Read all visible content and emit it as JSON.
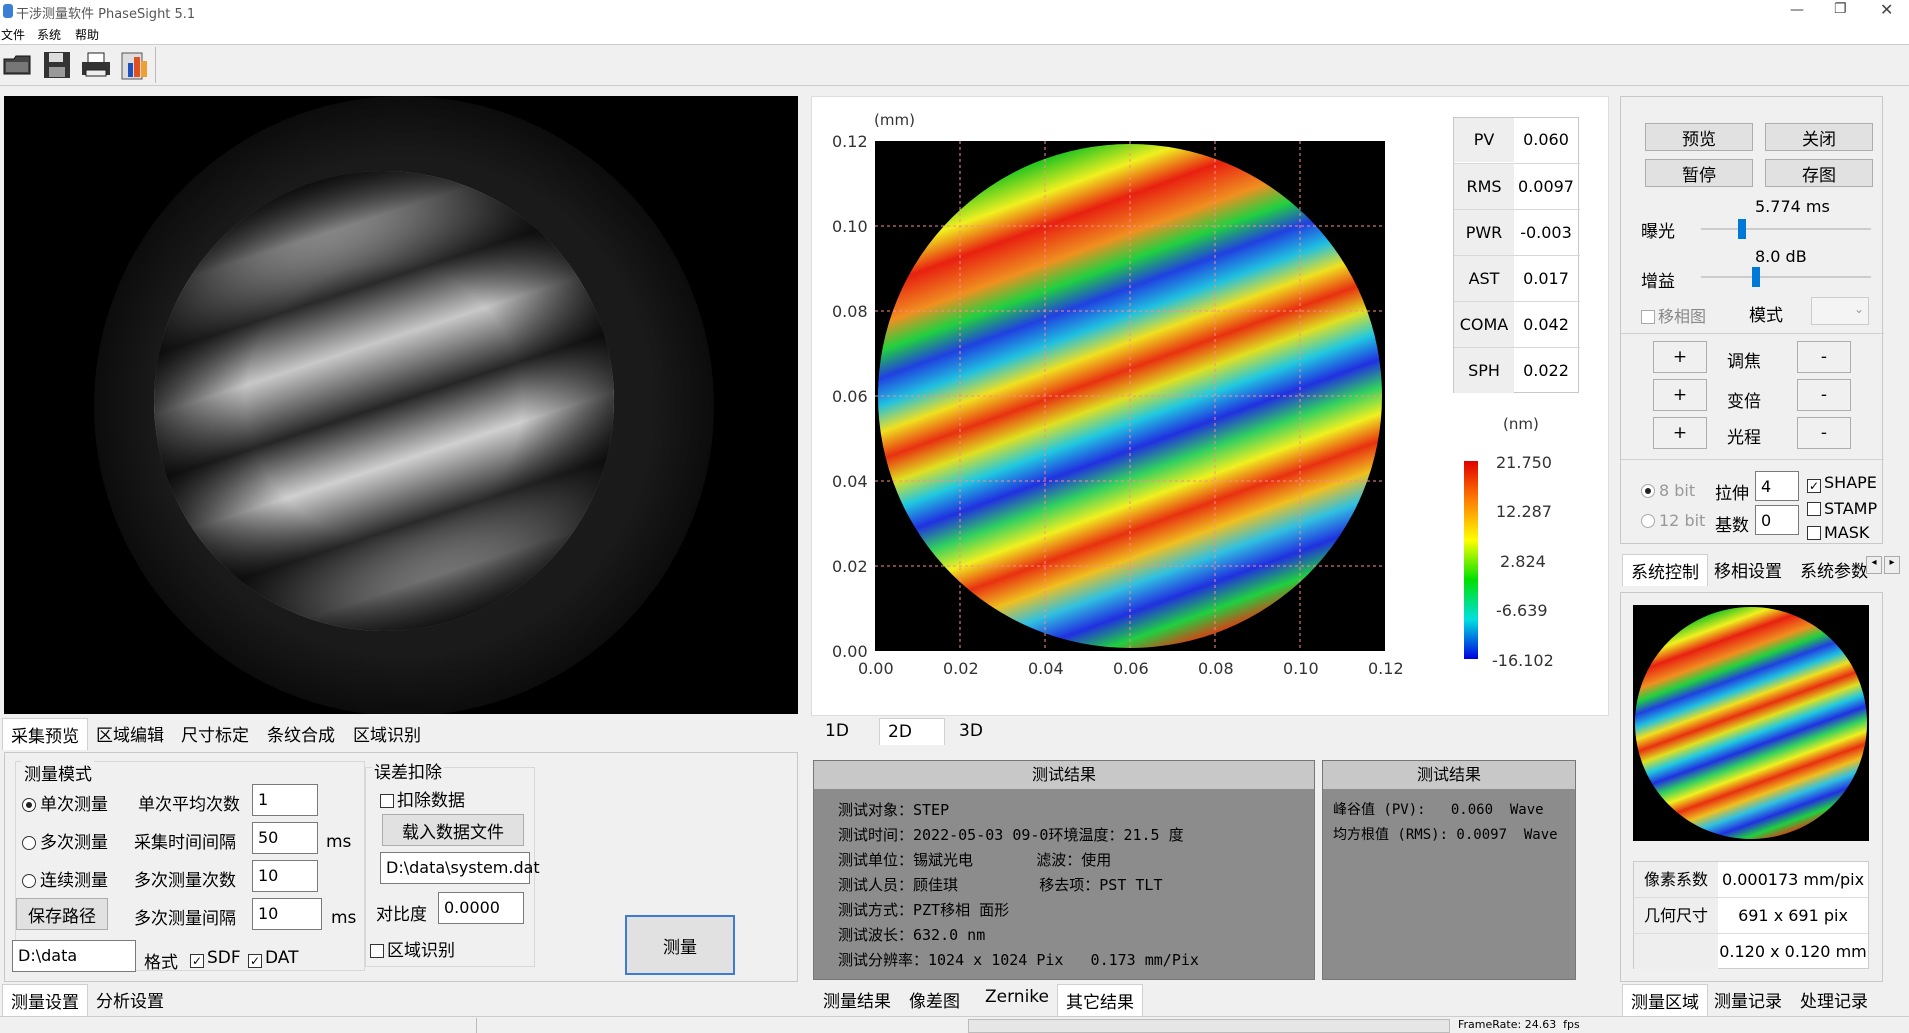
{
  "window": {
    "title": "干涉测量软件 PhaseSight 5.1"
  },
  "menu": [
    "文件",
    "系统",
    "帮助"
  ],
  "toolbar_icons": [
    "open-icon",
    "save-icon",
    "print-icon",
    "report-icon"
  ],
  "left_tabs": [
    "采集预览",
    "区域编辑",
    "尺寸标定",
    "条纹合成",
    "区域识别"
  ],
  "measure_mode": {
    "title": "测量模式",
    "options": [
      "单次测量",
      "多次测量",
      "连续测量"
    ],
    "selected": 0,
    "save_path_label": "保存路径",
    "path_value": "D:\\data",
    "format_label": "格式",
    "sdf_label": "SDF",
    "dat_label": "DAT",
    "avg_label": "单次平均次数",
    "avg_value": "1",
    "interval_label": "采集时间间隔",
    "interval_value": "50",
    "interval_unit": "ms",
    "count_label": "多次测量次数",
    "count_value": "10",
    "multi_interval_label": "多次测量间隔",
    "multi_interval_value": "10",
    "multi_interval_unit": "ms"
  },
  "error_removal": {
    "title": "误差扣除",
    "deduct_label": "扣除数据",
    "load_button": "载入数据文件",
    "file_value": "D:\\data\\system.dat",
    "contrast_label": "对比度",
    "contrast_value": "0.0000",
    "region_label": "区域识别"
  },
  "measure_button": "测量",
  "bottom_left_tabs": [
    "测量设置",
    "分析设置"
  ],
  "plot": {
    "unit": "(mm)",
    "y_ticks": [
      "0.12",
      "0.10",
      "0.08",
      "0.06",
      "0.04",
      "0.02",
      "0.00"
    ],
    "x_ticks": [
      "0.00",
      "0.02",
      "0.04",
      "0.06",
      "0.08",
      "0.10",
      "0.12"
    ]
  },
  "stats": [
    {
      "name": "PV",
      "value": "0.060"
    },
    {
      "name": "RMS",
      "value": "0.0097"
    },
    {
      "name": "PWR",
      "value": "-0.003"
    },
    {
      "name": "AST",
      "value": "0.017"
    },
    {
      "name": "COMA",
      "value": "0.042"
    },
    {
      "name": "SPH",
      "value": "0.022"
    }
  ],
  "colorbar": {
    "unit": "(nm)",
    "labels": [
      "21.750",
      "12.287",
      "2.824",
      "-6.639",
      "-16.102"
    ]
  },
  "view_tabs": [
    "1D",
    "2D",
    "3D"
  ],
  "result_panel": {
    "title": "测试结果",
    "lines": [
      "测试对象：STEP",
      "测试时间：2022-05-03 09-0环境温度：21.5 度",
      "测试单位：锡斌光电       滤波：使用",
      "测试人员：顾佳琪         移去项：PST TLT",
      "测试方式：PZT移相 面形",
      "测试波长：632.0 nm",
      "测试分辨率：1024 x 1024 Pix   0.173 mm/Pix"
    ]
  },
  "result_panel2": {
    "title": "测试结果",
    "lines": [
      "峰谷值 (PV):   0.060  Wave",
      "均方根值 (RMS): 0.0097  Wave"
    ]
  },
  "result_tabs": [
    "测量结果",
    "像差图",
    "Zernike",
    "其它结果"
  ],
  "controls": {
    "preview": "预览",
    "close": "关闭",
    "pause": "暂停",
    "save_image": "存图",
    "exposure_label": "曝光",
    "exposure_value": "5.774 ms",
    "exposure_level": 0.22,
    "gain_label": "增益",
    "gain_value": "8.0 dB",
    "gain_level": 0.3,
    "phase_map_label": "移相图",
    "mode_label": "模式",
    "focus_label": "调焦",
    "zoom_label": "变倍",
    "path_label": "光程",
    "plus": "+",
    "minus": "-",
    "bit8": "8 bit",
    "bit12": "12 bit",
    "stretch_label": "拉伸",
    "stretch_value": "4",
    "base_label": "基数",
    "base_value": "0",
    "shape": "SHAPE",
    "stamp": "STAMP",
    "mask": "MASK"
  },
  "right_tabs": [
    "系统控制",
    "移相设置",
    "系统参数"
  ],
  "info_table": [
    {
      "label": "像素系数",
      "value": "0.000173 mm/pix"
    },
    {
      "label": "几何尺寸",
      "value": "691 x 691 pix"
    },
    {
      "label": "",
      "value": "0.120 x 0.120 mm"
    }
  ],
  "bottom_right_tabs": [
    "测量区域",
    "测量记录",
    "处理记录"
  ],
  "status": {
    "framerate": "FrameRate: 24.63  fps"
  }
}
